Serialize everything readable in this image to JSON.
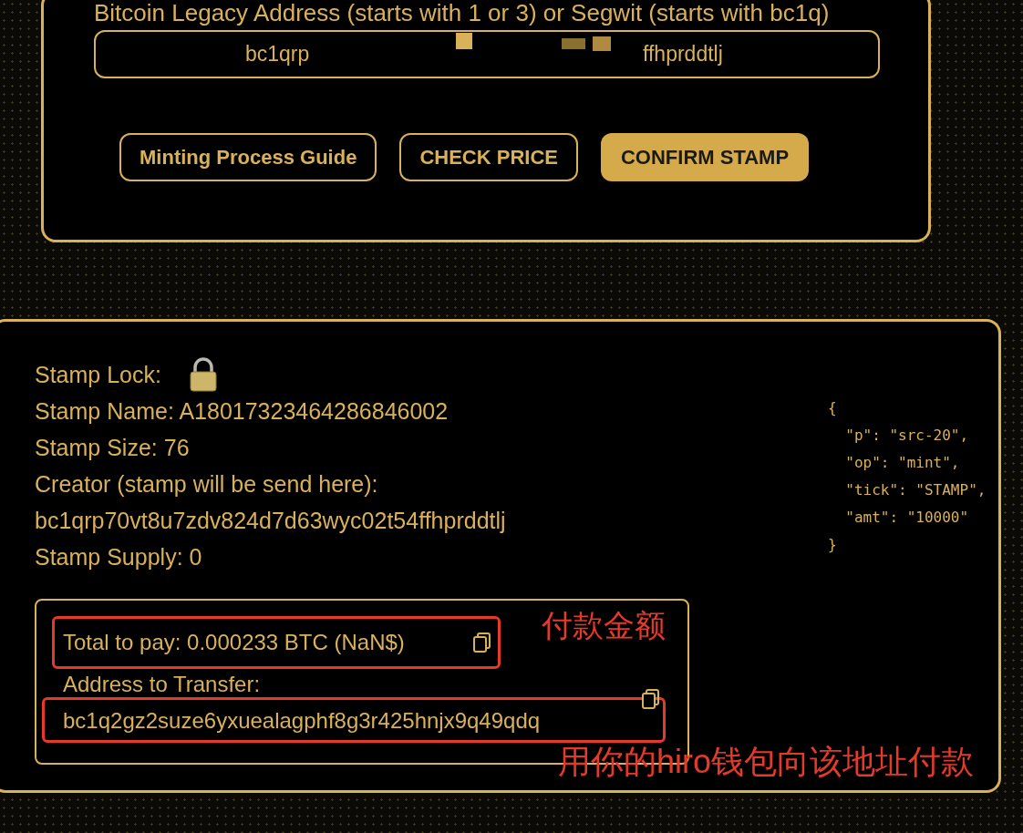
{
  "address_form": {
    "label": "Bitcoin Legacy Address (starts with 1 or 3) or Segwit (starts with bc1q)",
    "value_start": "bc1qrp",
    "value_end": "ffhprddtlj",
    "buttons": [
      {
        "label": "Minting Process Guide",
        "kind": "outline"
      },
      {
        "label": "CHECK PRICE",
        "kind": "outline"
      },
      {
        "label": "CONFIRM STAMP",
        "kind": "filled"
      }
    ]
  },
  "stamp_details": {
    "lock_label": "Stamp Lock:",
    "locked": true,
    "lines": [
      "Stamp Name: A18017323464286846002",
      "Stamp Size: 76",
      "Creator (stamp will be send here):",
      "bc1qrp70vt8u7zdv824d7d63wyc02t54ffhprddtlj",
      "Stamp Supply: 0"
    ],
    "json_lines": [
      "{",
      "  \"p\": \"src-20\",",
      "  \"op\": \"mint\",",
      "  \"tick\": \"STAMP\",",
      "  \"amt\": \"10000\"",
      "}"
    ],
    "payment": {
      "total": "Total to pay: 0.000233 BTC (NaN$)",
      "address_label": "Address to Transfer:",
      "address": "bc1q2gz2suze6yxuealagphf8g3r425hnjx9q49qdq"
    }
  },
  "annotations": [
    "付款金额",
    "用你的hiro钱包向该地址付款"
  ]
}
